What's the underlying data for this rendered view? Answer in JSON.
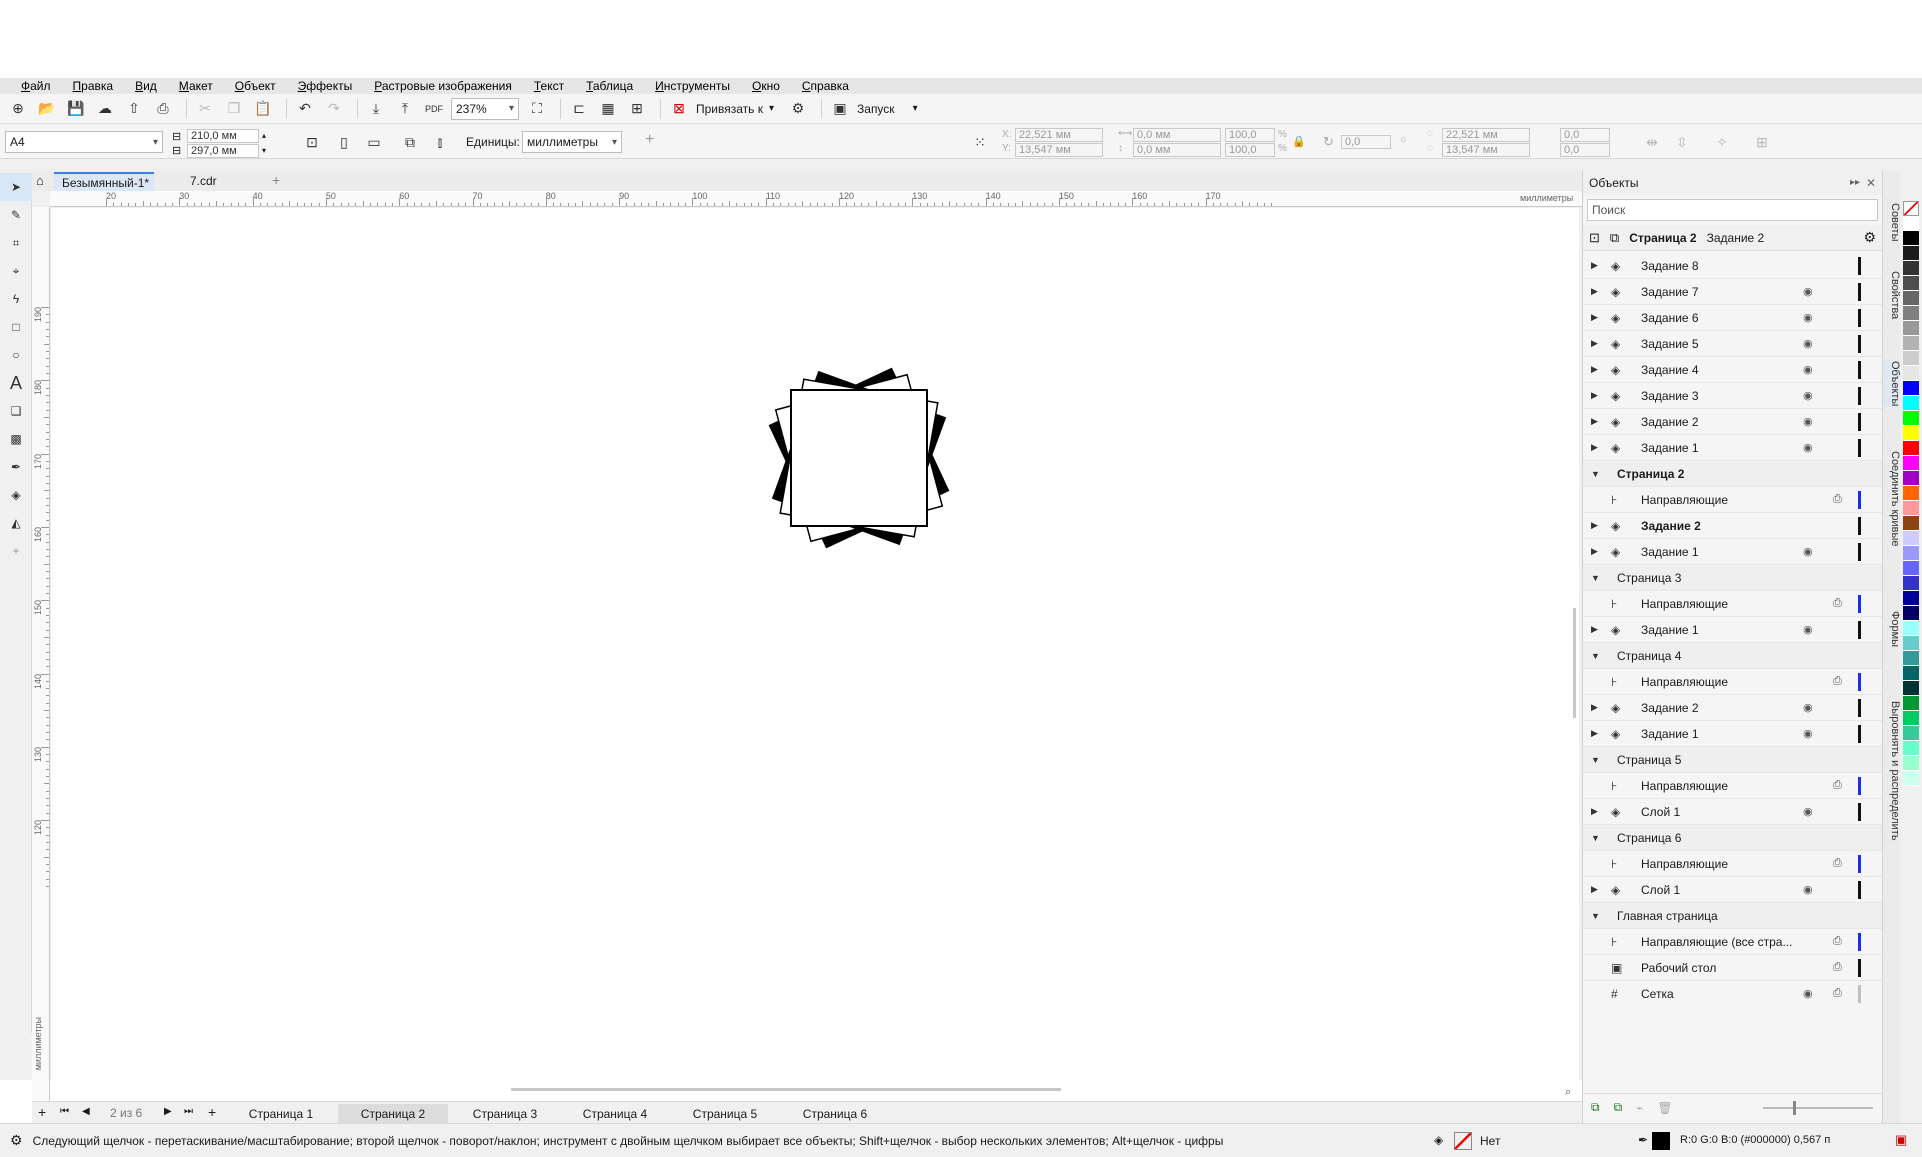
{
  "menu": [
    "Файл",
    "Правка",
    "Вид",
    "Макет",
    "Объект",
    "Эффекты",
    "Растровые изображения",
    "Текст",
    "Таблица",
    "Инструменты",
    "Окно",
    "Справка"
  ],
  "toolbar": {
    "zoom": "237%",
    "snap_label": "Привязать к",
    "launch_label": "Запуск"
  },
  "propbar": {
    "page_size": "A4",
    "width": "210,0 мм",
    "height": "297,0 мм",
    "units_label": "Единицы:",
    "units": "миллиметры",
    "x": "22,521 мм",
    "y": "13,547 мм",
    "w": "0,0 мм",
    "h": "0,0 мм",
    "scale_x": "100,0",
    "scale_y": "100,0",
    "pct": "%",
    "angle": "0,0",
    "x2": "22,521 мм",
    "y2": "13,547 мм",
    "off_x": "0,0",
    "off_y": "0,0",
    "x_label": "X:",
    "y_label": "Y:"
  },
  "doc_tabs": [
    "Безымянный-1*",
    "7.cdr"
  ],
  "ruler": {
    "h_labels": [
      "20",
      "30",
      "40",
      "50",
      "60",
      "70",
      "80",
      "90",
      "100",
      "110",
      "120",
      "130",
      "140",
      "150",
      "160",
      "170"
    ],
    "h_unit": "миллиметры",
    "v_labels": [
      "190",
      "180",
      "170",
      "160",
      "150",
      "140",
      "130",
      "120"
    ],
    "v_unit": "миллиметры"
  },
  "page_nav": {
    "counter": "2  из  6",
    "pages": [
      "Страница 1",
      "Страница 2",
      "Страница 3",
      "Страница 4",
      "Страница 5",
      "Страница 6"
    ],
    "active": 1
  },
  "status": {
    "hint": "Следующий щелчок - перетаскивание/масштабирование; второй щелчок - поворот/наклон; инструмент с двойным щелчком выбирает все объекты; Shift+щелчок - выбор нескольких элементов; Alt+щелчок - цифры",
    "fill": "Нет",
    "outline": "R:0 G:0 B:0 (#000000)  0,567 п"
  },
  "docker": {
    "title": "Объекты",
    "search_placeholder": "Поиск",
    "current_page": "Страница 2",
    "current_layer": "Задание 2",
    "rows": [
      {
        "type": "layer",
        "name": "Задание 8",
        "arrow": "▶",
        "eye": "",
        "swatch": "black"
      },
      {
        "type": "layer",
        "name": "Задание 7",
        "arrow": "▶",
        "eye": "👁",
        "swatch": "black"
      },
      {
        "type": "layer",
        "name": "Задание 6",
        "arrow": "▶",
        "eye": "👁",
        "swatch": "black"
      },
      {
        "type": "layer",
        "name": "Задание 5",
        "arrow": "▶",
        "eye": "👁",
        "swatch": "black"
      },
      {
        "type": "layer",
        "name": "Задание 4",
        "arrow": "▶",
        "eye": "👁",
        "swatch": "black"
      },
      {
        "type": "layer",
        "name": "Задание 3",
        "arrow": "▶",
        "eye": "👁",
        "swatch": "black"
      },
      {
        "type": "layer",
        "name": "Задание 2",
        "arrow": "▶",
        "eye": "👁",
        "swatch": "black"
      },
      {
        "type": "layer",
        "name": "Задание 1",
        "arrow": "▶",
        "eye": "👁",
        "swatch": "black"
      },
      {
        "type": "page",
        "name": "Страница 2",
        "bold": true
      },
      {
        "type": "guides",
        "name": "Направляющие",
        "swatch": "blue"
      },
      {
        "type": "layer",
        "name": "Задание 2",
        "arrow": "▶",
        "eye": "",
        "swatch": "black",
        "bold": true
      },
      {
        "type": "layer",
        "name": "Задание 1",
        "arrow": "▶",
        "eye": "👁",
        "swatch": "black"
      },
      {
        "type": "page",
        "name": "Страница 3"
      },
      {
        "type": "guides",
        "name": "Направляющие",
        "swatch": "blue"
      },
      {
        "type": "layer",
        "name": "Задание 1",
        "arrow": "▶",
        "eye": "👁",
        "swatch": "black"
      },
      {
        "type": "page",
        "name": "Страница 4"
      },
      {
        "type": "guides",
        "name": "Направляющие",
        "swatch": "blue"
      },
      {
        "type": "layer",
        "name": "Задание 2",
        "arrow": "▶",
        "eye": "👁",
        "swatch": "black"
      },
      {
        "type": "layer",
        "name": "Задание 1",
        "arrow": "▶",
        "eye": "👁",
        "swatch": "black"
      },
      {
        "type": "page",
        "name": "Страница 5"
      },
      {
        "type": "guides",
        "name": "Направляющие",
        "swatch": "blue"
      },
      {
        "type": "layer",
        "name": "Слой 1",
        "arrow": "▶",
        "eye": "👁",
        "swatch": "black"
      },
      {
        "type": "page",
        "name": "Страница 6"
      },
      {
        "type": "guides",
        "name": "Направляющие",
        "swatch": "blue"
      },
      {
        "type": "layer",
        "name": "Слой 1",
        "arrow": "▶",
        "eye": "👁",
        "swatch": "black"
      },
      {
        "type": "page",
        "name": "Главная страница"
      },
      {
        "type": "guides",
        "name": "Направляющие (все стра...",
        "swatch": "blue"
      },
      {
        "type": "desktop",
        "name": "Рабочий стол",
        "swatch": "black"
      },
      {
        "type": "grid",
        "name": "Сетка",
        "eye": "👁",
        "swatch": "gray"
      }
    ]
  },
  "side_tabs": [
    "Советы",
    "Свойства",
    "Объекты",
    "Соединить кривые",
    "Формы",
    "Выровнять и распределить"
  ],
  "palette": [
    "#ffffff",
    "#000000",
    "#1a1a1a",
    "#333333",
    "#4d4d4d",
    "#666666",
    "#808080",
    "#999999",
    "#b3b3b3",
    "#cccccc",
    "#e6e6e6",
    "#0000ff",
    "#00ffff",
    "#00ff00",
    "#ffff00",
    "#ff0000",
    "#ff00ff",
    "#a000c8",
    "#ff6600",
    "#ff9999",
    "#8b4513",
    "#ccccff",
    "#9999ff",
    "#6666ff",
    "#3333cc",
    "#000099",
    "#000066",
    "#99ffff",
    "#66cccc",
    "#339999",
    "#006666",
    "#003333",
    "#009933",
    "#00cc66",
    "#33cc99",
    "#66ffcc",
    "#99ffcc",
    "#ccffee"
  ]
}
